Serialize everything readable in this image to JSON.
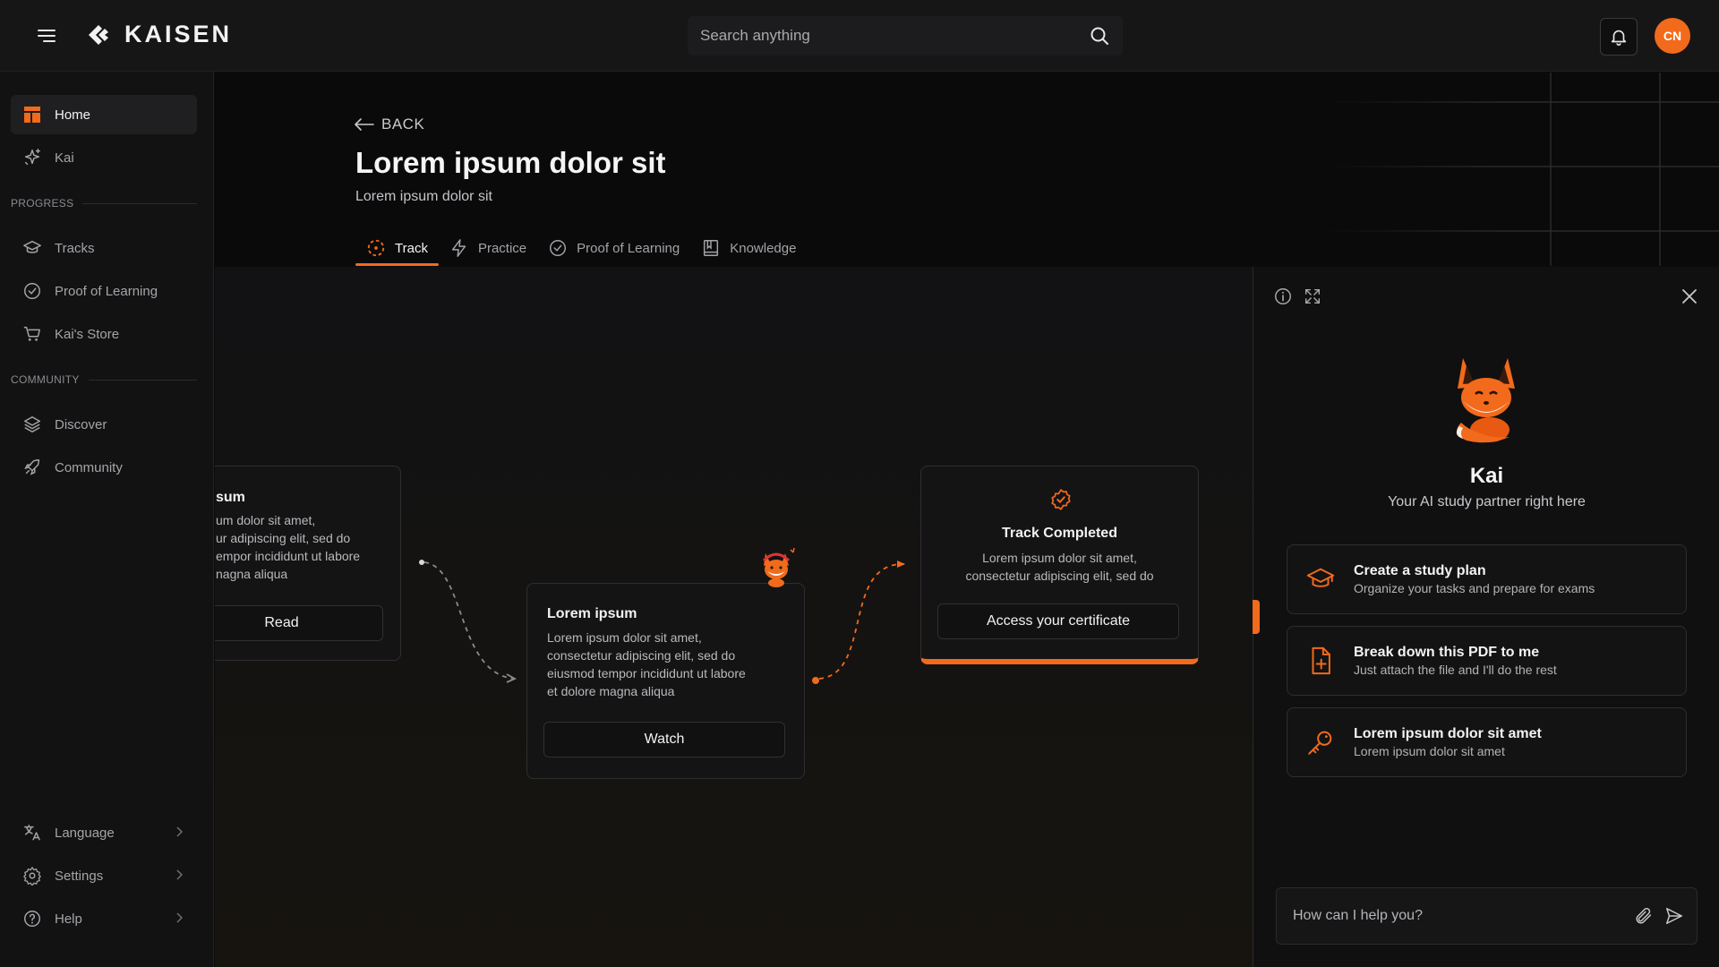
{
  "app": {
    "name": "KAISEN"
  },
  "header": {
    "search_placeholder": "Search anything",
    "avatar_initials": "CN"
  },
  "sidebar": {
    "top_items": [
      {
        "label": "Home",
        "icon": "home-icon",
        "active": true
      },
      {
        "label": "Kai",
        "icon": "sparkle-icon",
        "active": false
      }
    ],
    "progress_label": "PROGRESS",
    "progress_items": [
      {
        "label": "Tracks",
        "icon": "graduation-cap-icon"
      },
      {
        "label": "Proof of Learning",
        "icon": "check-circle-icon"
      },
      {
        "label": "Kai's Store",
        "icon": "cart-icon"
      }
    ],
    "community_label": "COMMUNITY",
    "community_items": [
      {
        "label": "Discover",
        "icon": "layers-icon"
      },
      {
        "label": "Community",
        "icon": "rocket-icon"
      }
    ],
    "bottom_items": [
      {
        "label": "Language",
        "icon": "translate-icon"
      },
      {
        "label": "Settings",
        "icon": "gear-icon"
      },
      {
        "label": "Help",
        "icon": "help-circle-icon"
      }
    ]
  },
  "page": {
    "back_label": "BACK",
    "title": "Lorem ipsum dolor sit",
    "subtitle": "Lorem ipsum dolor sit",
    "tabs": [
      {
        "label": "Track",
        "icon": "dashed-circle-icon",
        "active": true
      },
      {
        "label": "Practice",
        "icon": "lightning-icon",
        "active": false
      },
      {
        "label": "Proof of Learning",
        "icon": "check-circle-icon",
        "active": false
      },
      {
        "label": "Knowledge",
        "icon": "book-icon",
        "active": false
      }
    ]
  },
  "track": {
    "cards": [
      {
        "title": "sum",
        "lines": [
          "um dolor sit amet,",
          "ur adipiscing elit, sed do",
          "empor incididunt ut labore",
          "nagna aliqua"
        ],
        "button": "Read"
      },
      {
        "title": "Lorem ipsum",
        "lines": [
          "Lorem ipsum dolor sit amet,",
          "consectetur adipiscing elit, sed do",
          "eiusmod tempor incididunt ut labore",
          "et dolore magna aliqua"
        ],
        "button": "Watch"
      },
      {
        "title": "Track Completed",
        "lines": [
          "Lorem ipsum dolor sit amet,",
          "consectetur adipiscing elit, sed do"
        ],
        "button": "Access your certificate"
      }
    ]
  },
  "kai_panel": {
    "name": "Kai",
    "tagline": "Your AI study partner right here",
    "options": [
      {
        "title": "Create a study plan",
        "subtitle": "Organize your tasks and prepare for exams",
        "icon": "graduation-cap-icon"
      },
      {
        "title": "Break down this PDF to me",
        "subtitle": "Just attach the file and I'll do the rest",
        "icon": "file-plus-icon"
      },
      {
        "title": "Lorem ipsum dolor sit amet",
        "subtitle": "Lorem ipsum dolor sit amet",
        "icon": "key-icon"
      }
    ],
    "input_placeholder": "How can I help you?"
  },
  "colors": {
    "accent": "#f26a1b",
    "background": "#0b0b0c",
    "panel": "#101011"
  }
}
